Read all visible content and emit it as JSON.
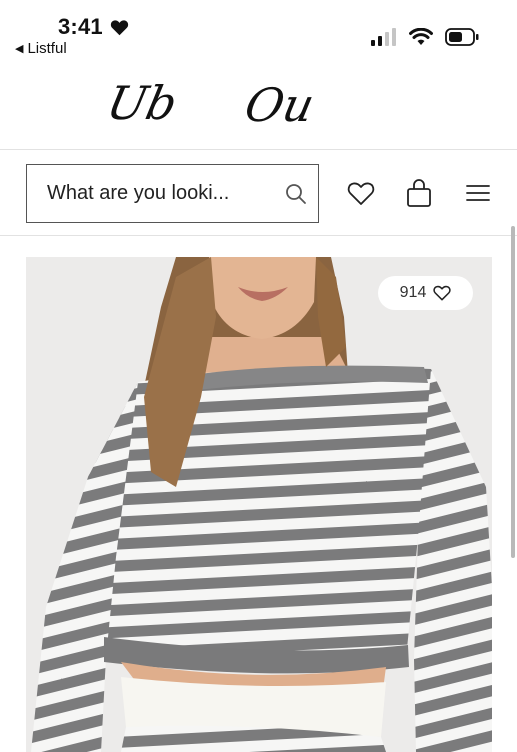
{
  "status_bar": {
    "time": "3:41",
    "back_app": "Listful",
    "icons": [
      "heart-icon",
      "signal-icon",
      "wifi-icon",
      "battery-icon"
    ]
  },
  "logo": {
    "left": "Ub",
    "right": "Ou"
  },
  "search": {
    "placeholder": "What are you looki..."
  },
  "header_icons": [
    "wishlist-heart-icon",
    "shopping-bag-icon",
    "menu-icon"
  ],
  "product": {
    "like_count": "914",
    "colors": {
      "stripe_gray": "#7b7b7c",
      "stripe_white": "#f6f6f5",
      "background": "#ecebea"
    }
  }
}
